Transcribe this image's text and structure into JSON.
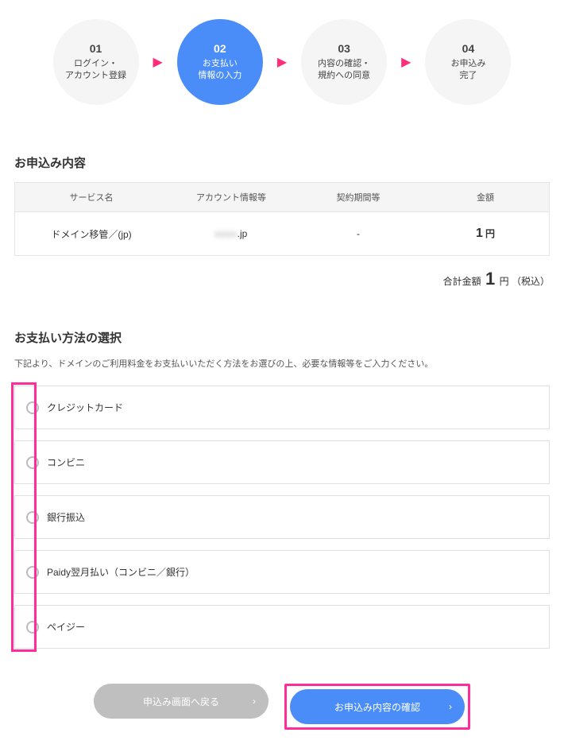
{
  "stepper": {
    "steps": [
      {
        "num": "01",
        "label": "ログイン・\nアカウント登録"
      },
      {
        "num": "02",
        "label": "お支払い\n情報の入力"
      },
      {
        "num": "03",
        "label": "内容の確認・\n規約への同意"
      },
      {
        "num": "04",
        "label": "お申込み\n完了"
      }
    ],
    "active_index": 1
  },
  "order": {
    "heading": "お申込み内容",
    "columns": {
      "service": "サービス名",
      "account": "アカウント情報等",
      "period": "契約期間等",
      "amount": "金額"
    },
    "rows": [
      {
        "service": "ドメイン移管／(jp)",
        "account_suffix": ".jp",
        "period": "-",
        "amount_value": "1",
        "amount_unit": "円"
      }
    ],
    "total": {
      "label": "合計金額",
      "value": "1",
      "unit": "円",
      "tax": "（税込）"
    }
  },
  "payment": {
    "heading": "お支払い方法の選択",
    "sub": "下記より、ドメインのご利用料金をお支払いいただく方法をお選びの上、必要な情報等をご入力ください。",
    "options": [
      "クレジットカード",
      "コンビニ",
      "銀行振込",
      "Paidy翌月払い（コンビニ／銀行）",
      "ペイジー"
    ]
  },
  "footer": {
    "back": "申込み画面へ戻る",
    "confirm": "お申込み内容の確認"
  }
}
